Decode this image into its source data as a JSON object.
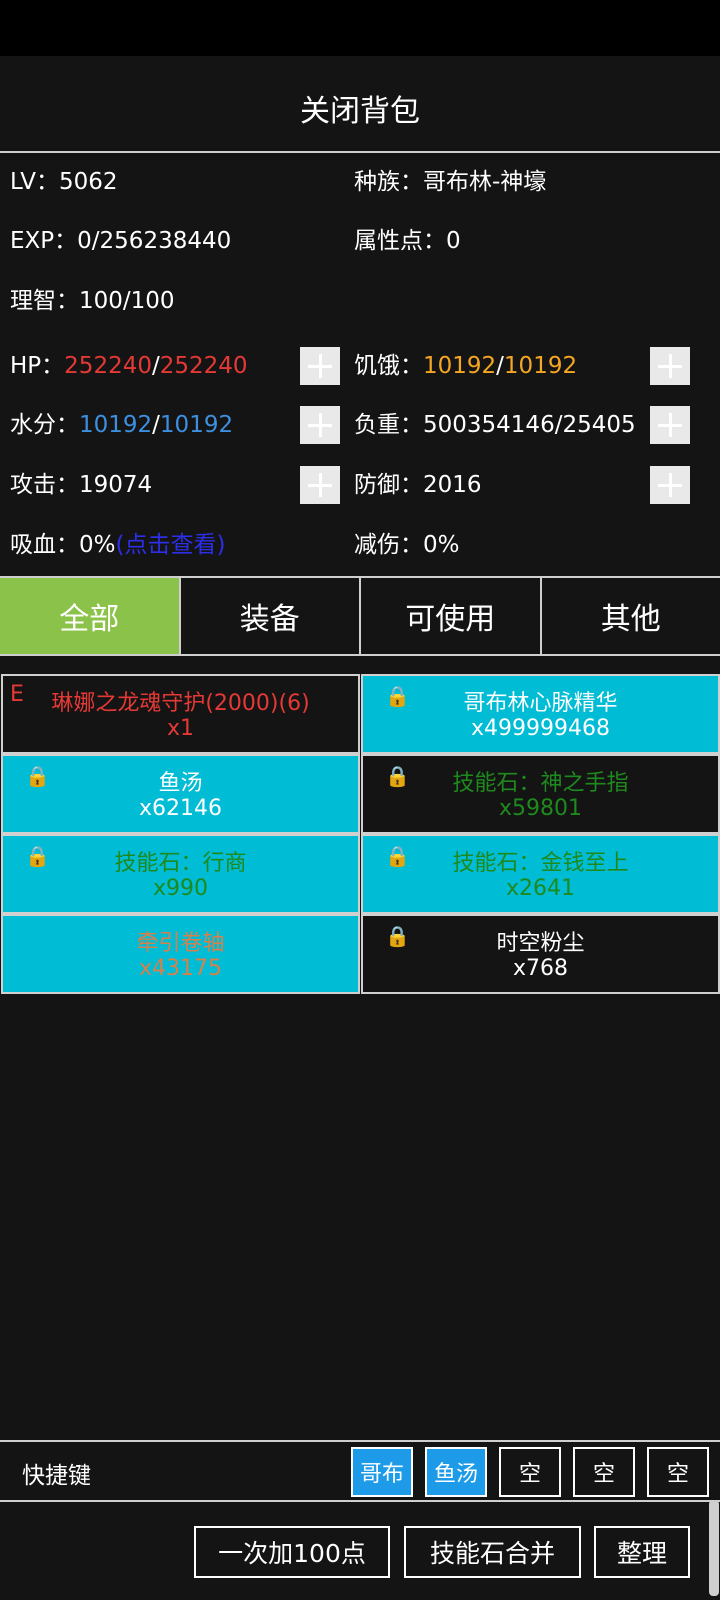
{
  "header": {
    "title": "关闭背包"
  },
  "stats": {
    "lv": "LV：5062",
    "race": "种族：哥布林-神壕",
    "exp": "EXP：0/256238440",
    "attr_points": "属性点：0",
    "sanity": "理智：100/100",
    "hp_label": "HP：",
    "hp_current": "252240",
    "hp_sep": "/",
    "hp_max": "252240",
    "hunger_label": "饥饿：",
    "hunger_current": "10192",
    "hunger_sep": "/",
    "hunger_max": "10192",
    "water_label": "水分：",
    "water_current": "10192",
    "water_sep": "/",
    "water_max": "10192",
    "load": "负重：500354146/25405",
    "attack": "攻击：19074",
    "defense": "防御：2016",
    "lifesteal_label": "吸血：0%",
    "lifesteal_link": "(点击查看)",
    "damage_reduction": "减伤：0%"
  },
  "tabs": [
    "全部",
    "装备",
    "可使用",
    "其他"
  ],
  "items": [
    {
      "name": "琳娜之龙魂守护(2000)(6)",
      "qty": "x1",
      "mark": "E",
      "bg": "#141414",
      "text_color": "#e53935"
    },
    {
      "name": "哥布林心脉精华",
      "qty": "x499999468",
      "bg": "#00bcd4",
      "text_color": "#ffffff",
      "icon": "lock-icon"
    },
    {
      "name": "鱼汤",
      "qty": "x62146",
      "bg": "#00bcd4",
      "text_color": "#ffffff",
      "icon": "lock-icon"
    },
    {
      "name": "技能石：神之手指",
      "qty": "x59801",
      "bg": "#141414",
      "text_color": "#1e8a1e",
      "icon": "lock-icon"
    },
    {
      "name": "技能石：行商",
      "qty": "x990",
      "bg": "#00bcd4",
      "text_color": "#1e8a1e",
      "icon": "lock-icon"
    },
    {
      "name": "技能石：金钱至上",
      "qty": "x2641",
      "bg": "#00bcd4",
      "text_color": "#1e8a1e",
      "icon": "lock-icon"
    },
    {
      "name": "牵引卷轴",
      "qty": "x43175",
      "bg": "#00bcd4",
      "text_color": "#d9804a"
    },
    {
      "name": "时空粉尘",
      "qty": "x768",
      "bg": "#141414",
      "text_color": "#ffffff",
      "icon": "lock-icon"
    }
  ],
  "quickbar": {
    "label": "快捷键",
    "slots": [
      "哥布",
      "鱼汤",
      "空",
      "空",
      "空"
    ]
  },
  "actions": {
    "add_100": "一次加100点",
    "merge_stones": "技能石合并",
    "sort": "整理"
  }
}
